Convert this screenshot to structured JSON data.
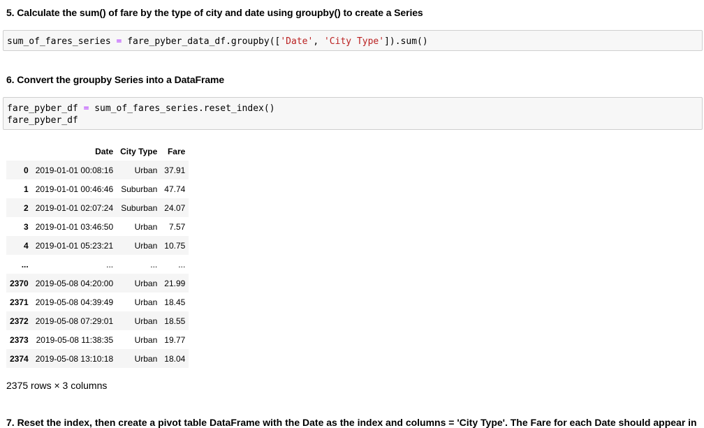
{
  "cells": {
    "heading5": "5. Calculate the sum() of fare by the type of city and date using groupby() to create a Series",
    "code5": {
      "var": "sum_of_fares_series",
      "op": "=",
      "rhs1": "fare_pyber_data_df.groupby([",
      "str1": "'Date'",
      "comma": ", ",
      "str2": "'City Type'",
      "rhs2": "]).sum()"
    },
    "heading6": "6. Convert the groupby Series into a DataFrame",
    "code6": {
      "var": "fare_pyber_df",
      "op": "=",
      "rhs": "sum_of_fares_series.reset_index()",
      "line2": "fare_pyber_df"
    },
    "heading7_partial": "7. Reset the index, then create a pivot table DataFrame with the Date as the index and columns = 'City Type'. The Fare for each Date should appear in"
  },
  "dataframe": {
    "columns": [
      "",
      "Date",
      "City Type",
      "Fare"
    ],
    "rows": [
      [
        "0",
        "2019-01-01 00:08:16",
        "Urban",
        "37.91"
      ],
      [
        "1",
        "2019-01-01 00:46:46",
        "Suburban",
        "47.74"
      ],
      [
        "2",
        "2019-01-01 02:07:24",
        "Suburban",
        "24.07"
      ],
      [
        "3",
        "2019-01-01 03:46:50",
        "Urban",
        "7.57"
      ],
      [
        "4",
        "2019-01-01 05:23:21",
        "Urban",
        "10.75"
      ],
      [
        "...",
        "...",
        "...",
        "..."
      ],
      [
        "2370",
        "2019-05-08 04:20:00",
        "Urban",
        "21.99"
      ],
      [
        "2371",
        "2019-05-08 04:39:49",
        "Urban",
        "18.45"
      ],
      [
        "2372",
        "2019-05-08 07:29:01",
        "Urban",
        "18.55"
      ],
      [
        "2373",
        "2019-05-08 11:38:35",
        "Urban",
        "19.77"
      ],
      [
        "2374",
        "2019-05-08 13:10:18",
        "Urban",
        "18.04"
      ]
    ],
    "shape_text": "2375 rows × 3 columns"
  }
}
